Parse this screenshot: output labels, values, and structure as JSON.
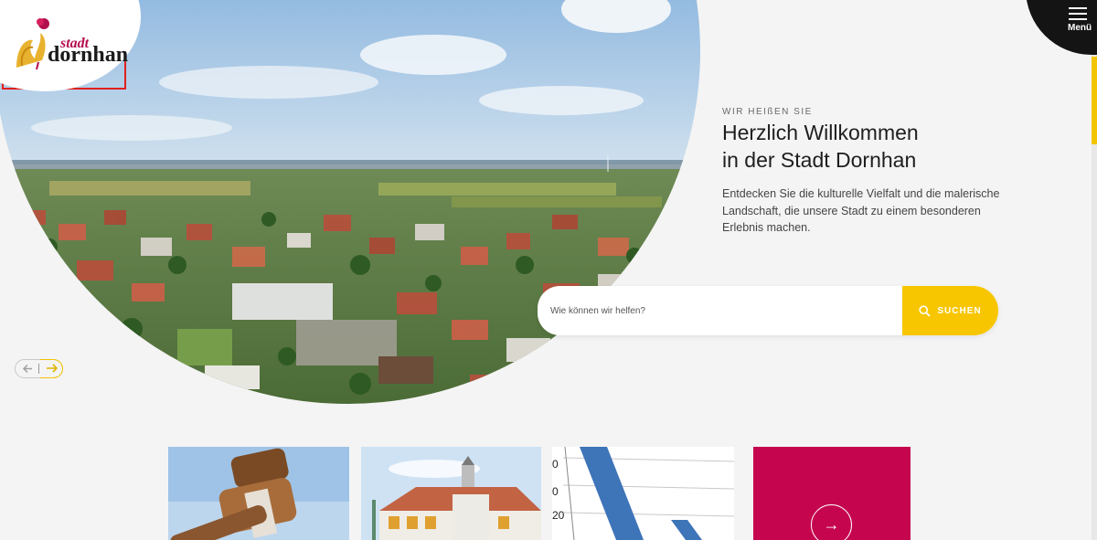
{
  "logo": {
    "line1": "stadt",
    "line2": "dornhan"
  },
  "menu": {
    "label": "Menü"
  },
  "welcome": {
    "kicker": "WIR HEIßEN SIE",
    "headline_line1": "Herzlich Willkommen",
    "headline_line2": "in der Stadt Dornhan",
    "intro": "Entdecken Sie die kulturelle Vielfalt und die malerische Landschaft, die unsere Stadt zu einem besonderen Erlebnis machen."
  },
  "search": {
    "placeholder": "Wie können wir helfen?",
    "button_label": "SUCHEN",
    "icon": "search-icon"
  },
  "slider": {
    "prev_icon": "arrow-left-icon",
    "next_icon": "arrow-right-icon"
  },
  "tiles": {
    "chart_ticks": [
      "0",
      "0",
      "20"
    ],
    "link_icon": "arrow-right-icon"
  },
  "colors": {
    "accent_yellow": "#f7c600",
    "brand_crimson": "#c5064f",
    "menu_bg": "#141414"
  }
}
